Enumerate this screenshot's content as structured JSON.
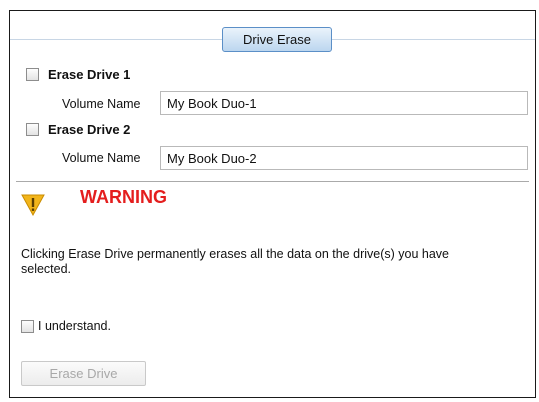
{
  "header": {
    "tab_label": "Drive Erase"
  },
  "drives": [
    {
      "label": "Erase Drive 1",
      "volume_label": "Volume Name",
      "volume_value": "My Book Duo-1"
    },
    {
      "label": "Erase Drive 2",
      "volume_label": "Volume Name",
      "volume_value": "My Book Duo-2"
    }
  ],
  "warning": {
    "title": "WARNING",
    "icon": "warning-triangle-icon",
    "icon_color": "#f2b51b",
    "title_color": "#e41e1e",
    "message": "Clicking Erase Drive permanently erases all the data on the drive(s) you have selected."
  },
  "confirm": {
    "label": "I understand."
  },
  "actions": {
    "erase_label": "Erase Drive"
  }
}
